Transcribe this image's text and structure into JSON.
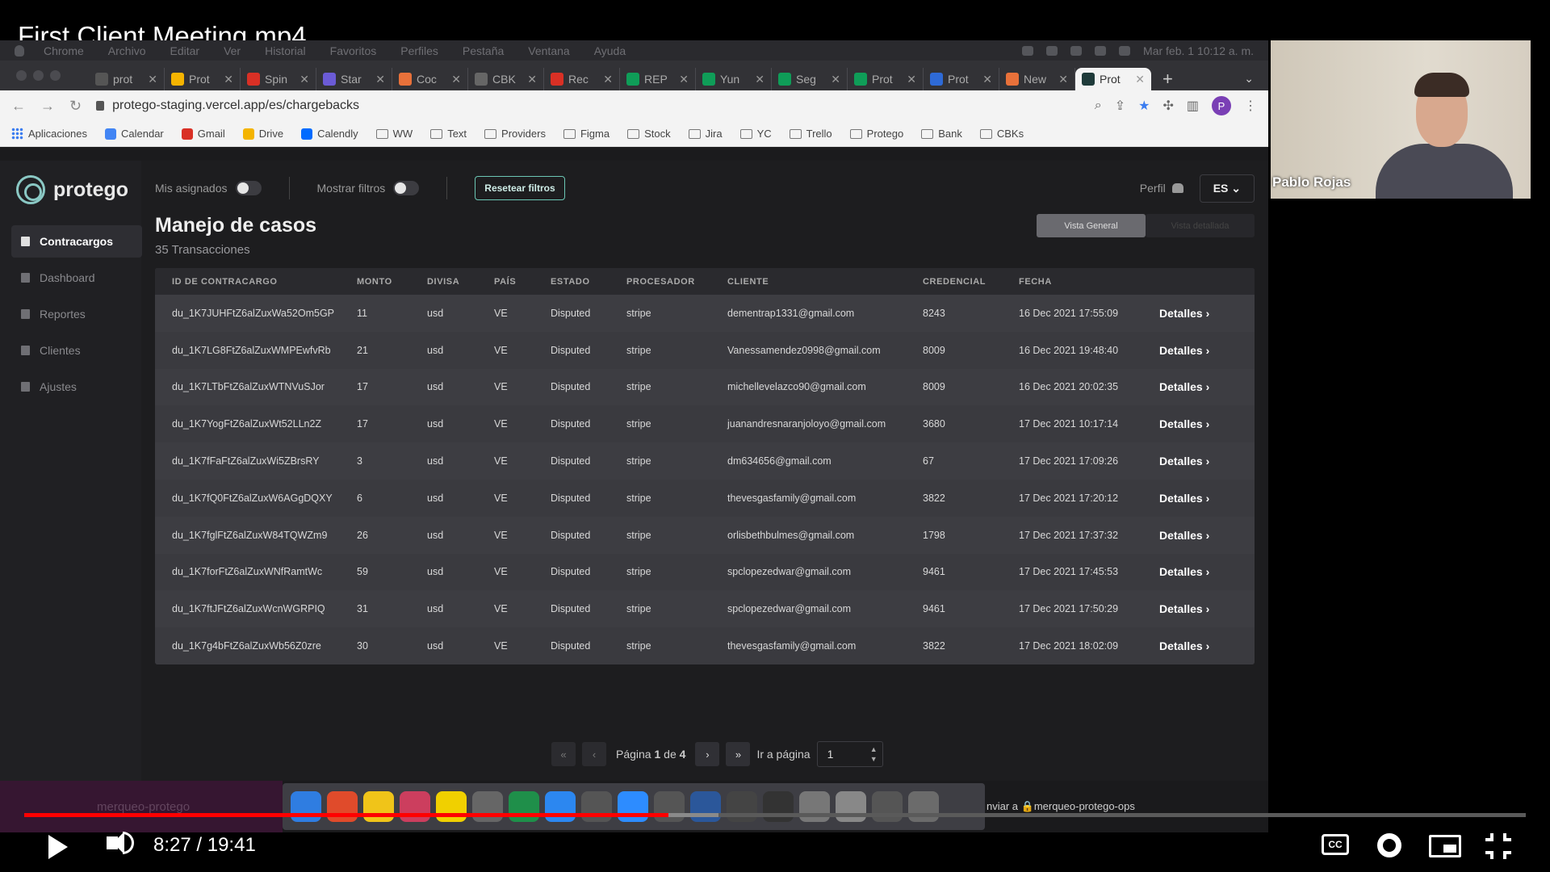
{
  "video": {
    "title": "First Client Meeting.mp4",
    "time_current": "8:27",
    "time_total": "19:41",
    "time_separator": " / ",
    "progress_fraction": 0.429,
    "cc_label": "CC"
  },
  "menubar": {
    "items": [
      "Chrome",
      "Archivo",
      "Editar",
      "Ver",
      "Historial",
      "Favoritos",
      "Perfiles",
      "Pestaña",
      "Ventana",
      "Ayuda"
    ],
    "clock": "Mar feb. 1  10:12 a. m."
  },
  "browser": {
    "tabs": [
      {
        "label": "prot",
        "color": "#555555"
      },
      {
        "label": "Prot",
        "color": "#f5b400"
      },
      {
        "label": "Spin",
        "color": "#d93025"
      },
      {
        "label": "Star",
        "color": "#6b5bd6"
      },
      {
        "label": "Coc",
        "color": "#e8713a"
      },
      {
        "label": "CBK",
        "color": "#666666"
      },
      {
        "label": "Rec",
        "color": "#d93025"
      },
      {
        "label": "REP",
        "color": "#0f9d58"
      },
      {
        "label": "Yun",
        "color": "#0f9d58"
      },
      {
        "label": "Seg",
        "color": "#0f9d58"
      },
      {
        "label": "Prot",
        "color": "#0f9d58"
      },
      {
        "label": "Prot",
        "color": "#2e6ad6"
      },
      {
        "label": "New",
        "color": "#e8713a"
      },
      {
        "label": "Prot",
        "color": "#1f3b3a"
      }
    ],
    "url": "protego-staging.vercel.app/es/chargebacks",
    "profile_initial": "P",
    "bookmarks": [
      {
        "label": "Aplicaciones",
        "icon": "apps-grid-icon"
      },
      {
        "label": "Calendar",
        "icon": "calendar-icon",
        "color": "#4285f4"
      },
      {
        "label": "Gmail",
        "icon": "gmail-icon",
        "color": "#d93025"
      },
      {
        "label": "Drive",
        "icon": "drive-icon",
        "color": "#f4b400"
      },
      {
        "label": "Calendly",
        "icon": "calendly-icon",
        "color": "#006bff"
      },
      {
        "label": "WW",
        "icon": "folder-icon"
      },
      {
        "label": "Text",
        "icon": "folder-icon"
      },
      {
        "label": "Providers",
        "icon": "folder-icon"
      },
      {
        "label": "Figma",
        "icon": "folder-icon"
      },
      {
        "label": "Stock",
        "icon": "folder-icon"
      },
      {
        "label": "Jira",
        "icon": "folder-icon"
      },
      {
        "label": "YC",
        "icon": "folder-icon"
      },
      {
        "label": "Trello",
        "icon": "folder-icon"
      },
      {
        "label": "Protego",
        "icon": "folder-icon"
      },
      {
        "label": "Bank",
        "icon": "folder-icon"
      },
      {
        "label": "CBKs",
        "icon": "folder-icon"
      }
    ]
  },
  "app": {
    "brand": "protego",
    "sidebar": [
      {
        "label": "Contracargos",
        "active": true
      },
      {
        "label": "Dashboard",
        "active": false
      },
      {
        "label": "Reportes",
        "active": false
      },
      {
        "label": "Clientes",
        "active": false
      },
      {
        "label": "Ajustes",
        "active": false
      }
    ],
    "topbar": {
      "mis_asignados": "Mis asignados",
      "mostrar_filtros": "Mostrar filtros",
      "reset": "Resetear filtros",
      "perfil": "Perfil",
      "lang": "ES"
    },
    "title": "Manejo de casos",
    "subtitle": "35 Transacciones",
    "view_toggle": {
      "on": "Vista General",
      "off": "Vista detallada"
    },
    "table": {
      "headers": [
        "ID DE CONTRACARGO",
        "MONTO",
        "DIVISA",
        "PAÍS",
        "ESTADO",
        "PROCESADOR",
        "CLIENTE",
        "CREDENCIAL",
        "FECHA"
      ],
      "rows": [
        [
          "du_1K7JUHFtZ6alZuxWa52Om5GP",
          "11",
          "usd",
          "VE",
          "Disputed",
          "stripe",
          "dementrap1331@gmail.com",
          "8243",
          "16 Dec 2021 17:55:09"
        ],
        [
          "du_1K7LG8FtZ6alZuxWMPEwfvRb",
          "21",
          "usd",
          "VE",
          "Disputed",
          "stripe",
          "Vanessamendez0998@gmail.com",
          "8009",
          "16 Dec 2021 19:48:40"
        ],
        [
          "du_1K7LTbFtZ6alZuxWTNVuSJor",
          "17",
          "usd",
          "VE",
          "Disputed",
          "stripe",
          "michellevelazco90@gmail.com",
          "8009",
          "16 Dec 2021 20:02:35"
        ],
        [
          "du_1K7YogFtZ6alZuxWt52LLn2Z",
          "17",
          "usd",
          "VE",
          "Disputed",
          "stripe",
          "juanandresnaranjoloyo@gmail.com",
          "3680",
          "17 Dec 2021 10:17:14"
        ],
        [
          "du_1K7fFaFtZ6alZuxWi5ZBrsRY",
          "3",
          "usd",
          "VE",
          "Disputed",
          "stripe",
          "dm634656@gmail.com",
          "67",
          "17 Dec 2021 17:09:26"
        ],
        [
          "du_1K7fQ0FtZ6alZuxW6AGgDQXY",
          "6",
          "usd",
          "VE",
          "Disputed",
          "stripe",
          "thevesgasfamily@gmail.com",
          "3822",
          "17 Dec 2021 17:20:12"
        ],
        [
          "du_1K7fglFtZ6alZuxW84TQWZm9",
          "26",
          "usd",
          "VE",
          "Disputed",
          "stripe",
          "orlisbethbulmes@gmail.com",
          "1798",
          "17 Dec 2021 17:37:32"
        ],
        [
          "du_1K7forFtZ6alZuxWNfRamtWc",
          "59",
          "usd",
          "VE",
          "Disputed",
          "stripe",
          "spclopezedwar@gmail.com",
          "9461",
          "17 Dec 2021 17:45:53"
        ],
        [
          "du_1K7ftJFtZ6alZuxWcnWGRPIQ",
          "31",
          "usd",
          "VE",
          "Disputed",
          "stripe",
          "spclopezedwar@gmail.com",
          "9461",
          "17 Dec 2021 17:50:29"
        ],
        [
          "du_1K7g4bFtZ6alZuxWb56Z0zre",
          "30",
          "usd",
          "VE",
          "Disputed",
          "stripe",
          "thevesgasfamily@gmail.com",
          "3822",
          "17 Dec 2021 18:02:09"
        ]
      ],
      "details_label": "Detalles"
    },
    "pager": {
      "page_prefix": "Página",
      "page": "1",
      "of": "de",
      "total": "4",
      "goto": "Ir a página",
      "input_value": "1"
    }
  },
  "dock": {
    "left_ghost": "merqueo-protego",
    "right_text": "nviar a 🔒merqueo-protego-ops",
    "icon_colors": [
      "#2f7de1",
      "#e04b2b",
      "#f0c419",
      "#cc3e5e",
      "#f0d000",
      "#666666",
      "#1f8f4a",
      "#2c87f0",
      "#555555",
      "#2d8cff",
      "#555555",
      "#2b579a",
      "#444444",
      "#333333",
      "#777777",
      "#888888",
      "#555555",
      "#6b6b6b"
    ]
  },
  "webcam": {
    "name": "Pablo Rojas"
  }
}
